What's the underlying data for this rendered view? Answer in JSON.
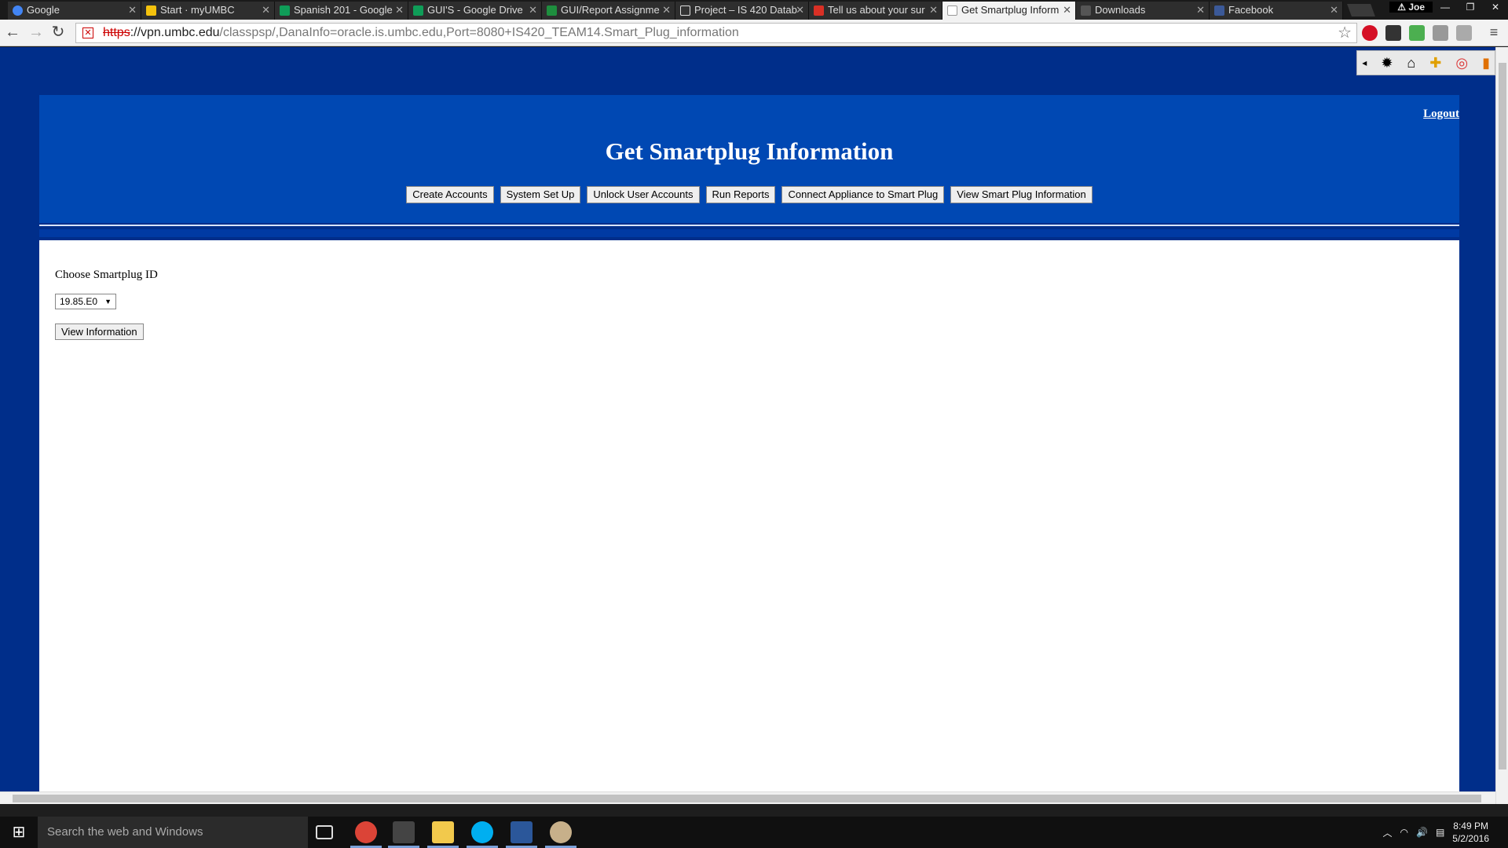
{
  "browser": {
    "tabs": [
      {
        "label": "Google",
        "favicon_color": "#4285f4"
      },
      {
        "label": "Start · myUMBC",
        "favicon_color": "#f4c20d"
      },
      {
        "label": "Spanish 201 - Google",
        "favicon_color": "#0f9d58"
      },
      {
        "label": "GUI'S - Google Drive",
        "favicon_color": "#0f9d58"
      },
      {
        "label": "GUI/Report Assignme",
        "favicon_color": "#1e8e3e"
      },
      {
        "label": "Project – IS 420 Datab",
        "favicon_color": "#333333"
      },
      {
        "label": "Tell us about your sur",
        "favicon_color": "#d93025"
      },
      {
        "label": "Get Smartplug Inform",
        "favicon_color": "#ffffff",
        "active": true
      },
      {
        "label": "Downloads",
        "favicon_color": "#888888"
      },
      {
        "label": "Facebook",
        "favicon_color": "#3b5998"
      }
    ],
    "user": "Joe",
    "url": {
      "scheme": "https",
      "host": "://vpn.umbc.edu",
      "path": "/classpsp/,DanaInfo=oracle.is.umbc.edu,Port=8080+IS420_TEAM14.Smart_Plug_information"
    }
  },
  "page": {
    "logout_label": "Logout",
    "title": "Get Smartplug Information",
    "nav_buttons": [
      "Create Accounts",
      "System Set Up",
      "Unlock User Accounts",
      "Run Reports",
      "Connect Appliance to Smart Plug",
      "View Smart Plug Information"
    ],
    "form": {
      "prompt": "Choose Smartplug ID",
      "selected_id": "19.85.E0",
      "submit_label": "View Information"
    }
  },
  "taskbar": {
    "search_placeholder": "Search the web and Windows",
    "time": "8:49 PM",
    "date": "5/2/2016"
  }
}
